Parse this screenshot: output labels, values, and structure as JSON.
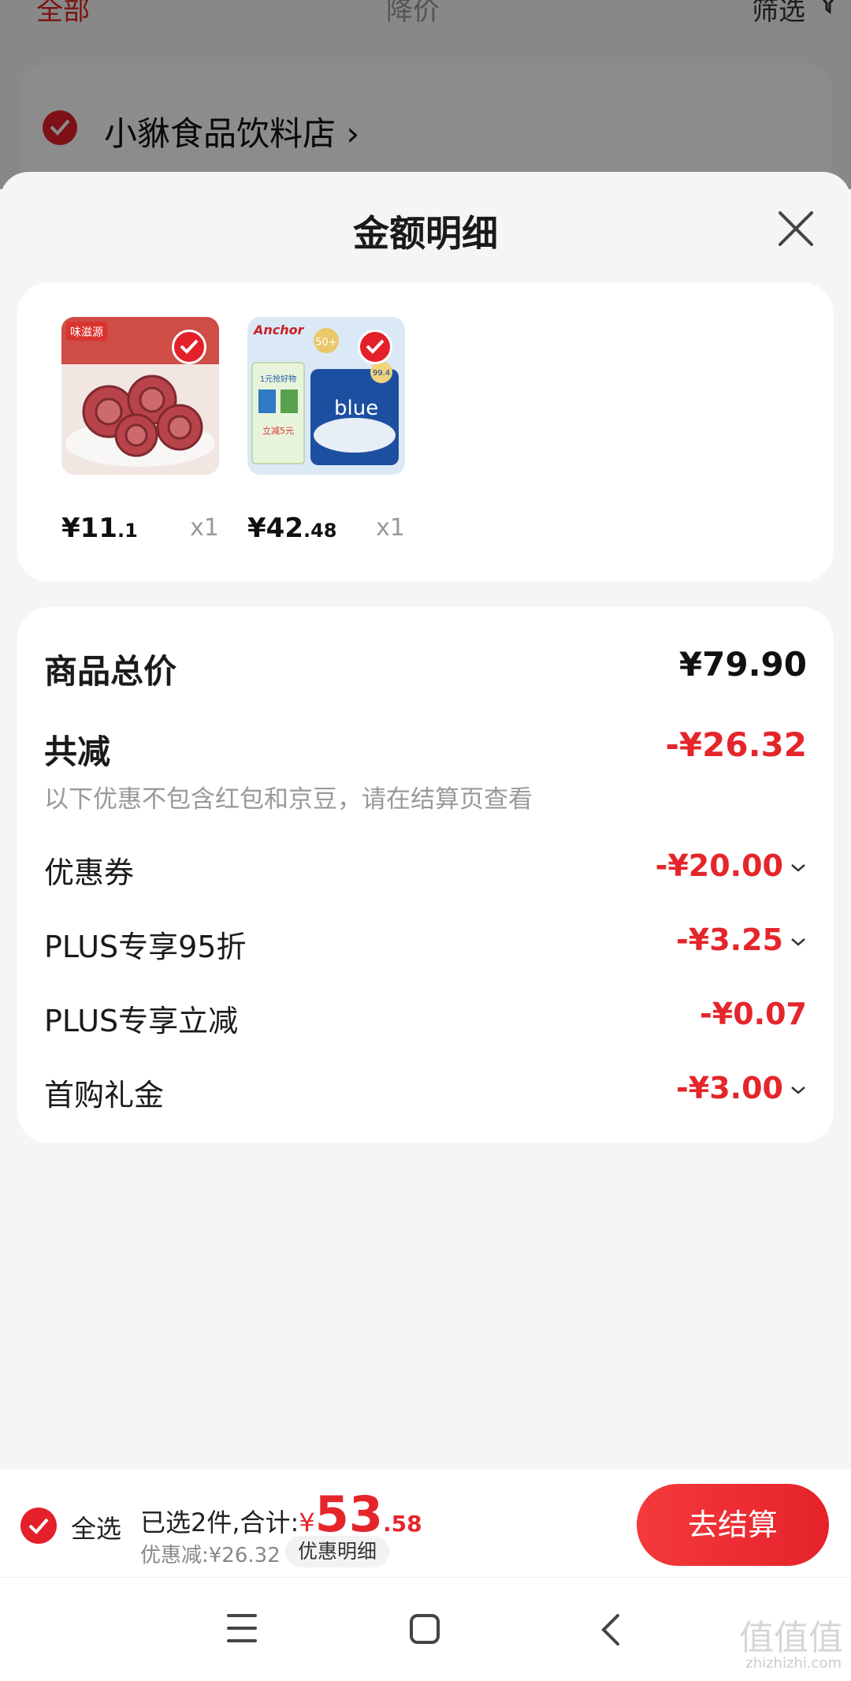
{
  "background": {
    "tabs": [
      "全部",
      "降价",
      "筛选"
    ],
    "store_name": "小貅食品饮料店",
    "store_chevron": "›"
  },
  "sheet": {
    "title": "金额明细"
  },
  "products": [
    {
      "price_int": "¥11",
      "price_dec": ".1",
      "qty": "x1",
      "brand_text": "味滋源"
    },
    {
      "price_int": "¥42",
      "price_dec": ".48",
      "qty": "x1",
      "brand_text": "Anchor",
      "promo_text": "1元抢好物",
      "promo_text_2": "立减5元",
      "product_text": "blue",
      "badge_text": "50+",
      "badge_pct": "99.4"
    }
  ],
  "summary": {
    "goods_total_label": "商品总价",
    "goods_total_value": "¥79.90",
    "total_reduce_label": "共减",
    "total_reduce_value": "-¥26.32",
    "note": "以下优惠不包含红包和京豆，请在结算页查看",
    "items": [
      {
        "label": "优惠券",
        "value": "-¥20.00",
        "chevron": true
      },
      {
        "label": "PLUS专享95折",
        "value": "-¥3.25",
        "chevron": true
      },
      {
        "label": "PLUS专享立减",
        "value": "-¥0.07",
        "chevron": false
      },
      {
        "label": "首购礼金",
        "value": "-¥3.00",
        "chevron": true
      }
    ]
  },
  "bottom_bar": {
    "select_all": "全选",
    "selected_text": "已选2件,合计:",
    "currency": "¥",
    "total_int": "53",
    "total_dec": ".58",
    "discount_text": "优惠减:¥26.32",
    "detail_pill": "优惠明细",
    "checkout": "去结算"
  },
  "watermark": {
    "text": "值值值",
    "sub": "zhizhizhi.com"
  },
  "colors": {
    "accent_red": "#e4262b",
    "sheet_bg": "#f5f5f5",
    "card_bg": "#ffffff"
  }
}
